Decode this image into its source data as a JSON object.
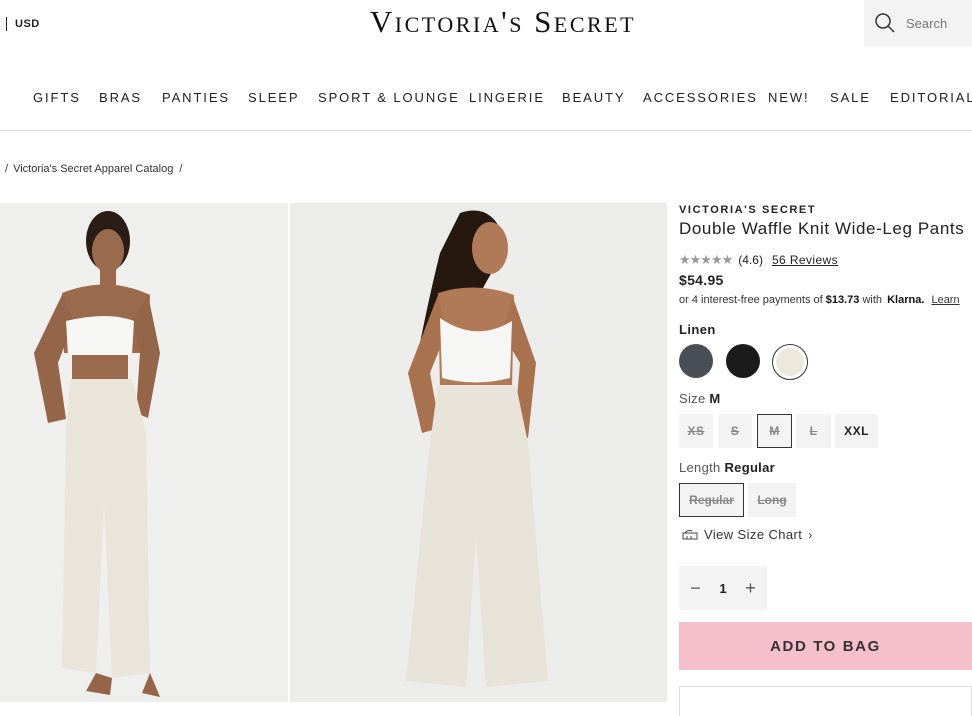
{
  "header": {
    "currency": "USD",
    "logo": "Victoria's Secret",
    "search_placeholder": "Search"
  },
  "nav": [
    "GIFTS",
    "BRAS",
    "PANTIES",
    "SLEEP",
    "SPORT & LOUNGE",
    "LINGERIE",
    "BEAUTY",
    "ACCESSORIES",
    "NEW!",
    "SALE",
    "EDITORIAL"
  ],
  "breadcrumb": {
    "prefix": "/",
    "item": "Victoria's Secret Apparel Catalog",
    "suffix": "/"
  },
  "product": {
    "brand": "VICTORIA'S SECRET",
    "name": "Double Waffle Knit Wide-Leg Pants",
    "rating_value": "(4.6)",
    "rating_stars": 4.6,
    "reviews_link": "56 Reviews",
    "price": "$54.95",
    "klarna": {
      "prefix": "or 4 interest-free payments of",
      "amount": "$13.73",
      "with": "with",
      "brand": "Klarna.",
      "link": "Learn"
    },
    "color_label": "Linen",
    "swatch_colors": [
      "#4a4e57",
      "#1b1b1b",
      "#ede8dc"
    ],
    "size_label": "Size",
    "size_value": "M",
    "sizes": [
      "XS",
      "S",
      "M",
      "L",
      "XXL"
    ],
    "length_label": "Length",
    "length_value": "Regular",
    "lengths": [
      "Regular",
      "Long"
    ],
    "size_chart_link": "View Size Chart",
    "quantity": "1",
    "add_to_bag": "ADD TO BAG"
  },
  "colors": {
    "add_to_bag_bg": "#f5bfcc",
    "chip_bg": "#f3f3f3"
  }
}
